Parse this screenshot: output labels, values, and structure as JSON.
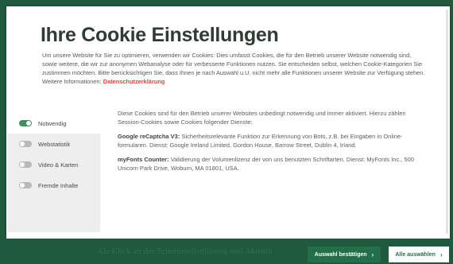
{
  "dialog": {
    "title": "Ihre Cookie Einstellungen",
    "intro": "Um unsere Website für Sie zu optimieren, verwenden wir Cookies: Dies umfasst Cookies, die für den Betrieb unserer Website notwendig sind, sowie weitere, die wir zur anonymen Webanalyse oder für verbesserte Funktionen nutzen. Sie entscheiden selbst, welchen Cookie-Kategorien Sie zustimmen möchten. Bitte berücksichtigen Sie, dass Ihnen je nach Auswahl u.U. nicht mehr alle Funktionen unserer Website zur Verfügung stehen. Weitere Informationen:",
    "privacy_link": "Datenschutzerklärung"
  },
  "sidebar": {
    "items": [
      {
        "label": "Notwendig",
        "enabled": true
      },
      {
        "label": "Webstatistik",
        "enabled": false
      },
      {
        "label": "Video & Karten",
        "enabled": false
      },
      {
        "label": "Fremde Inhalte",
        "enabled": false
      }
    ]
  },
  "content": {
    "description": "Diese Cookies sind für den Betrieb unserer Websites unbedingt notwendig und immer aktiviert. Hierzu zählen Session-Cookies sowie Cookies folgender Dienste:",
    "services": [
      {
        "name": "Google reCaptcha V3:",
        "text": "Sicherheitsrelevante Funktion zur Erkennung von Bots, z.B. bei Eingaben in Online-formularen. Dienst: Google Ireland Limited, Gordon House, Barrow Street, Dublin 4, Irland."
      },
      {
        "name": "myFonts Counter:",
        "text": "Validierung der Volumenlizenz der von uns benutzten Schriftarten. Dienst: MyFonts Inc., 500 Unicorn Park Drive, Woburn, MA 01801, USA."
      }
    ]
  },
  "footer": {
    "background_text": "Als Klick an der Schnittstellenlösung und Akustik",
    "confirm_label": "Auswahl bestätigen",
    "select_all_label": "Alle auswählen",
    "chevron_icon": "chevron-right-icon"
  },
  "colors": {
    "brand_green": "#1f5a3e",
    "button_green": "#236f49",
    "toggle_on": "#3e8f5e",
    "link_red": "#e1453a"
  }
}
